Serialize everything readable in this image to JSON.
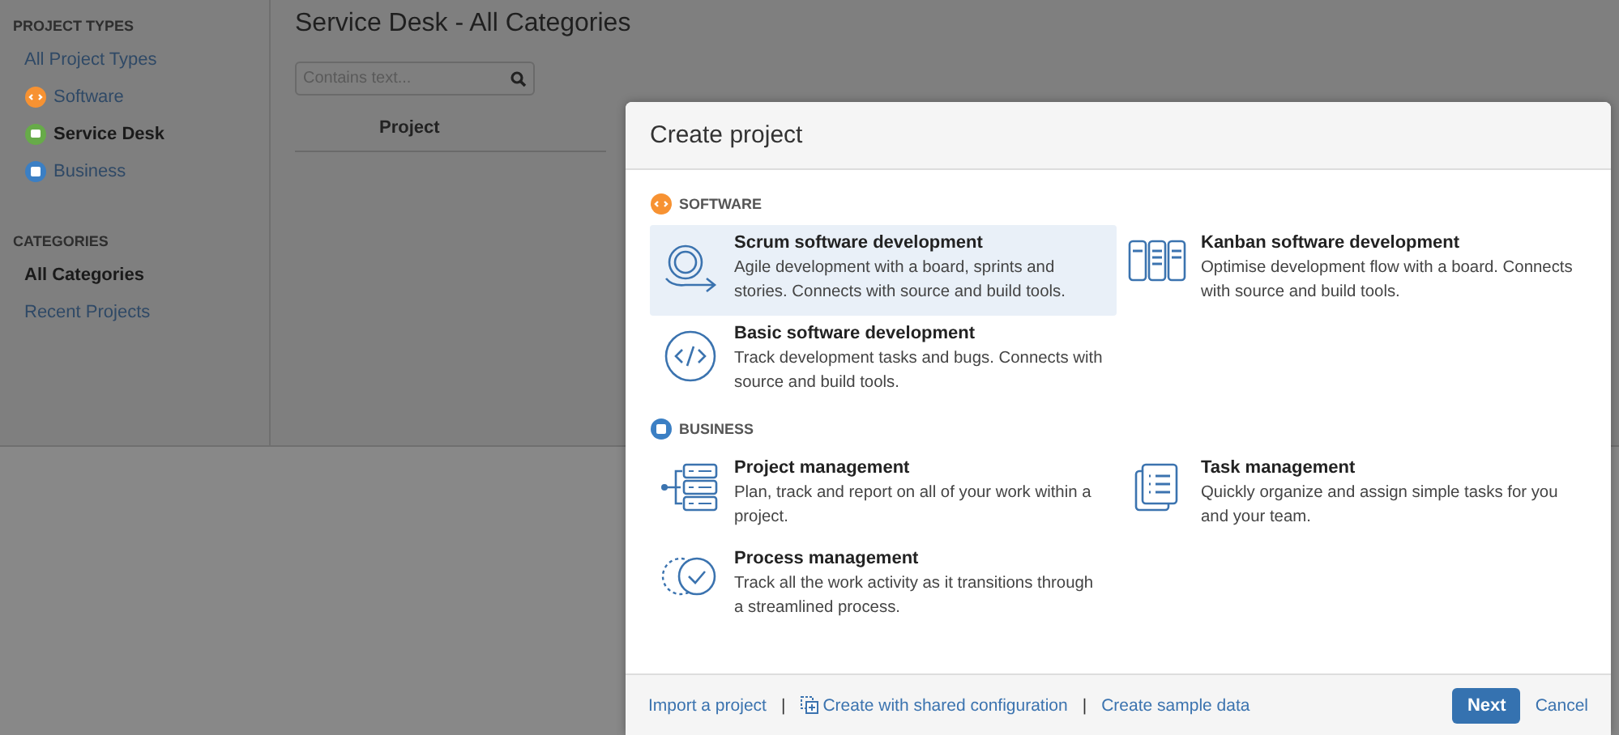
{
  "sidebar": {
    "sections": [
      {
        "heading": "PROJECT TYPES",
        "items": [
          {
            "label": "All Project Types",
            "selected": false,
            "kind": "plain"
          },
          {
            "label": "Software",
            "selected": false,
            "kind": "software",
            "color": "#f79232"
          },
          {
            "label": "Service Desk",
            "selected": true,
            "kind": "service-desk",
            "color": "#67ab49"
          },
          {
            "label": "Business",
            "selected": false,
            "kind": "business",
            "color": "#3b7fc4"
          }
        ]
      },
      {
        "heading": "CATEGORIES",
        "items": [
          {
            "label": "All Categories",
            "selected": true,
            "kind": "plain"
          },
          {
            "label": "Recent Projects",
            "selected": false,
            "kind": "plain"
          }
        ]
      }
    ]
  },
  "main": {
    "title": "Service Desk - All Categories",
    "search": {
      "placeholder": "Contains text..."
    },
    "table": {
      "columns": [
        "Project"
      ]
    }
  },
  "dialog": {
    "title": "Create project",
    "sections": [
      {
        "heading": "SOFTWARE",
        "kind": "software",
        "color": "#f79232",
        "options": [
          {
            "title": "Scrum software development",
            "description": "Agile development with a board, sprints and stories. Connects with source and build tools.",
            "selected": true,
            "kind": "scrum"
          },
          {
            "title": "Kanban software development",
            "description": "Optimise development flow with a board. Connects with source and build tools.",
            "selected": false,
            "kind": "kanban"
          },
          {
            "title": "Basic software development",
            "description": "Track development tasks and bugs. Connects with source and build tools.",
            "selected": false,
            "kind": "basic"
          }
        ]
      },
      {
        "heading": "BUSINESS",
        "kind": "business",
        "color": "#3b7fc4",
        "options": [
          {
            "title": "Project management",
            "description": "Plan, track and report on all of your work within a project.",
            "selected": false,
            "kind": "project"
          },
          {
            "title": "Task management",
            "description": "Quickly organize and assign simple tasks for you and your team.",
            "selected": false,
            "kind": "task"
          },
          {
            "title": "Process management",
            "description": "Track all the work activity as it transitions through a streamlined process.",
            "selected": false,
            "kind": "process"
          }
        ]
      }
    ],
    "footer_links": [
      {
        "label": "Import a project",
        "kind": "plain"
      },
      {
        "label": "Create with shared configuration",
        "kind": "shared"
      },
      {
        "label": "Create sample data",
        "kind": "plain"
      }
    ],
    "separators": [
      "|",
      "|"
    ],
    "buttons": [
      {
        "label": "Next",
        "kind": "primary"
      },
      {
        "label": "Cancel",
        "kind": "link"
      }
    ]
  }
}
